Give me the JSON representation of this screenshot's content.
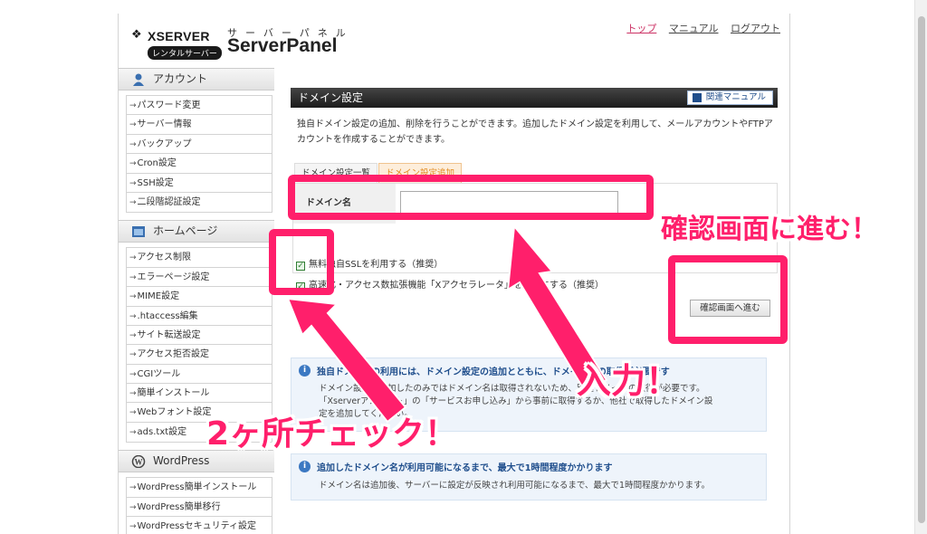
{
  "header": {
    "logo_text": "XSERVER",
    "logo_badge": "レンタルサーバー",
    "panel_kana": "サーバーパネル",
    "panel_title": "ServerPanel",
    "links": [
      "トップ",
      "マニュアル",
      "ログアウト"
    ]
  },
  "sidebar": {
    "account": {
      "title": "アカウント",
      "items": [
        "パスワード変更",
        "サーバー情報",
        "バックアップ",
        "Cron設定",
        "SSH設定",
        "二段階認証設定"
      ]
    },
    "homepage": {
      "title": "ホームページ",
      "items": [
        "アクセス制限",
        "エラーページ設定",
        "MIME設定",
        ".htaccess編集",
        "サイト転送設定",
        "アクセス拒否設定",
        "CGIツール",
        "簡単インストール",
        "Webフォント設定",
        "ads.txt設定"
      ]
    },
    "wordpress": {
      "title": "WordPress",
      "items": [
        "WordPress簡単インストール",
        "WordPress簡単移行",
        "WordPressセキュリティ設定"
      ]
    },
    "arrow": "→"
  },
  "main": {
    "title": "ドメイン設定",
    "manual_button": "関連マニュアル",
    "description_line1": "独自ドメイン設定の追加、削除を行うことができます。追加したドメイン設定を利用して、メールアカウントやFTPア",
    "description_line2": "カウントを作成することができます。",
    "tabs": [
      "ドメイン設定一覧",
      "ドメイン設定追加"
    ],
    "domain_label": "ドメイン名",
    "domain_value": "",
    "checkbox1": "無料独自SSLを利用する（推奨）",
    "checkbox2": "高速化・アクセス数拡張機能「Xアクセラレータ」を有効にする（推奨）",
    "confirm_button": "確認画面へ進む",
    "info1": {
      "title": "独自ドメインの利用には、ドメイン設定の追加とともに、ドメイン名の取得が必要です",
      "line1": "ドメイン設定を追加したのみではドメイン名は取得されないため、別途ドメインの取得が必要です。",
      "line2": "「Xserverアカウント」の「サービスお申し込み」から事前に取得するか、他社で取得したドメイン設",
      "line3": "定を追加してください。"
    },
    "info2": {
      "title": "追加したドメイン名が利用可能になるまで、最大で1時間程度かかります",
      "line1": "ドメイン名は追加後、サーバーに設定が反映され利用可能になるまで、最大で1時間程度かかります。"
    }
  },
  "annotations": {
    "confirm_note": "確認画面に進む！",
    "input_note": "入力！",
    "check_note": "2ヶ所チェック！",
    "color": "#ff1f6b"
  }
}
